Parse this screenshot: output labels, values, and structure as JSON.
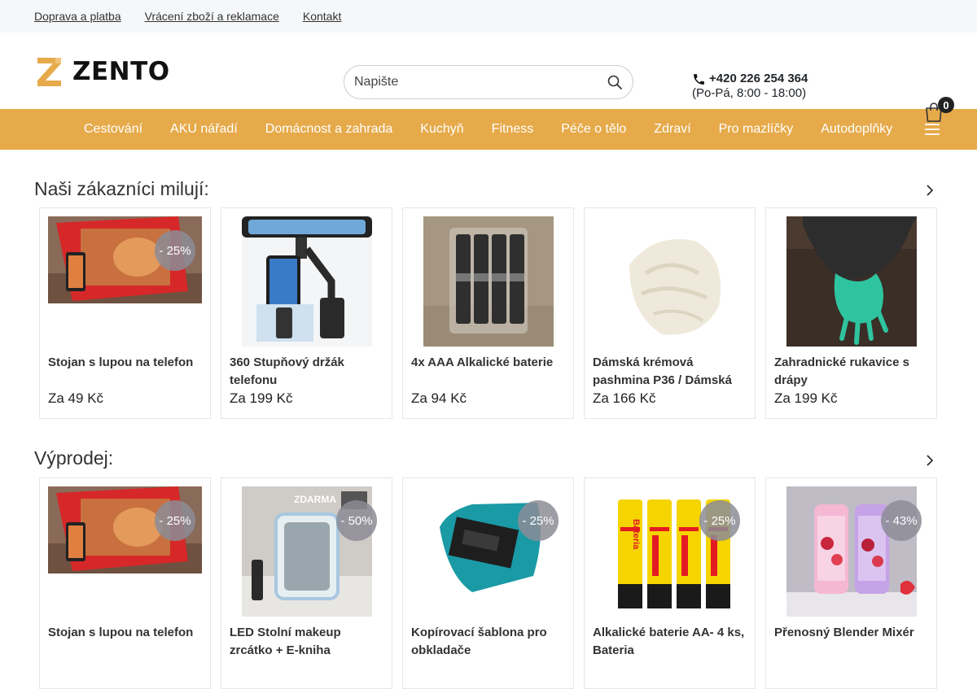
{
  "topbar": {
    "links": [
      "Doprava a platba",
      "Vrácení zboží a reklamace",
      "Kontakt"
    ]
  },
  "header": {
    "logo_text": "ZENTO",
    "brand_color": "#e6aa4a",
    "search_placeholder": "Napište",
    "phone": "+420 226 254 364",
    "hours": "(Po-Pá, 8:00 - 18:00)",
    "cart_count": "0"
  },
  "nav": {
    "items": [
      "Cestování",
      "AKU nářadí",
      "Domácnost a zahrada",
      "Kuchyň",
      "Fitness",
      "Péče o tělo",
      "Zdraví",
      "Pro mazlíčky",
      "Autodoplňky"
    ]
  },
  "sections": [
    {
      "title": "Naši zákazníci milují:",
      "products": [
        {
          "name": "Stojan s lupou na telefon",
          "price": "Za 49 Kč",
          "discount": "- 25%",
          "image": "phone-magnifier-stand"
        },
        {
          "name": "360 Stupňový držák telefonu",
          "price": "Za 199 Kč",
          "discount": "",
          "image": "car-mirror-phone-holder"
        },
        {
          "name": "4x AAA Alkalické baterie",
          "price": "Za 94 Kč",
          "discount": "",
          "image": "aaa-batteries"
        },
        {
          "name": "Dámská krémová pashmina P36 / Dámská",
          "price": "Za 166 Kč",
          "discount": "",
          "image": "cream-pashmina"
        },
        {
          "name": "Zahradnické rukavice s drápy",
          "price": "Za 199 Kč",
          "discount": "",
          "image": "garden-claw-gloves"
        }
      ]
    },
    {
      "title": "Výprodej:",
      "products": [
        {
          "name": "Stojan s lupou na telefon",
          "price": "",
          "discount": "- 25%",
          "image": "phone-magnifier-stand"
        },
        {
          "name": "LED Stolní makeup zrcátko + E-kniha ZDARMA",
          "price": "",
          "discount": "- 50%",
          "image": "led-makeup-mirror",
          "image_text": "ZDARMA"
        },
        {
          "name": "Kopírovací šablona pro obkladače",
          "price": "",
          "discount": "- 25%",
          "image": "contour-gauge"
        },
        {
          "name": "Alkalické baterie AA- 4 ks, Bateria",
          "price": "",
          "discount": "- 25%",
          "image": "aa-batteries",
          "image_text": "Bateria"
        },
        {
          "name": "Přenosný Blender Mixér",
          "price": "",
          "discount": "- 43%",
          "image": "portable-blender"
        }
      ]
    }
  ]
}
